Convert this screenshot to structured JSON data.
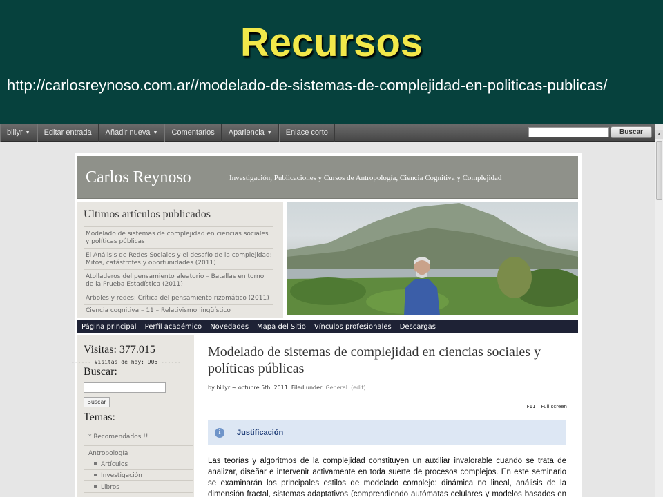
{
  "slide": {
    "title": "Recursos",
    "url": "http://carlosreynoso.com.ar//modelado-de-sistemas-de-complejidad-en-politicas-publicas/"
  },
  "admin_bar": {
    "items": [
      {
        "label": "billyr",
        "dropdown": true
      },
      {
        "label": "Editar entrada",
        "dropdown": false
      },
      {
        "label": "Añadir nueva",
        "dropdown": true
      },
      {
        "label": "Comentarios",
        "dropdown": false
      },
      {
        "label": "Apariencia",
        "dropdown": true
      },
      {
        "label": "Enlace corto",
        "dropdown": false
      }
    ],
    "search_value": "",
    "search_button": "Buscar"
  },
  "site": {
    "name": "Carlos Reynoso",
    "tagline": "Investigación, Publicaciones y Cursos de Antropología, Ciencia Cognitiva y Complejidad"
  },
  "recent": {
    "heading": "Ultimos artículos publicados",
    "items": [
      "Modelado de sistemas de complejidad en ciencias sociales y políticas públicas",
      "El Análisis de Redes Sociales y el desafío de la complejidad: Mitos, catástrofes y oportunidades (2011)",
      "Atolladeros del pensamiento aleatorio – Batallas en torno de la Prueba Estadística (2011)",
      "Arboles y redes: Crítica del pensamiento rizomático (2011)",
      "Ciencia cognitiva – 11 – Relativismo lingüístico"
    ]
  },
  "nav": {
    "items": [
      "Página principal",
      "Perfil académico",
      "Novedades",
      "Mapa del Sitio",
      "Vínculos profesionales",
      "Descargas"
    ]
  },
  "sidebar": {
    "visits": "Visitas: 377.015",
    "visits_today": "------ Visitas de hoy: 906 ------",
    "search_heading": "Buscar:",
    "search_value": "",
    "search_button": "Buscar",
    "topics_heading": "Temas:",
    "recommended": "* Recomendados !!",
    "category": "Antropología",
    "subcategories": [
      "Artículos",
      "Investigación",
      "Libros"
    ]
  },
  "post": {
    "title": "Modelado de sistemas de complejidad en ciencias sociales y políticas públicas",
    "meta_by": "by billyr ~ octubre 5th, 2011. Filed under:",
    "meta_category": "General.",
    "meta_edit": "(edit)",
    "fullscreen": "F11 – Full screen",
    "box_label": "Justificación",
    "body": "Las teorías y algoritmos de la complejidad constituyen un auxiliar invalorable cuando se trata de analizar, diseñar e intervenir activamente en toda suerte de procesos complejos. En este seminario se examinarán los principales estilos de modelado complejo: dinámica no lineal, análisis de la dimensión fractal, sistemas adaptativos (comprendiendo autómatas celulares y modelos basados en agentes), redes sociales y"
  },
  "colors": {
    "slide_bg": "#06413d",
    "slide_title": "#f2e84a",
    "banner": "#8f918a",
    "nav_bg": "#1e2235",
    "info_box": "#dde7f4"
  }
}
